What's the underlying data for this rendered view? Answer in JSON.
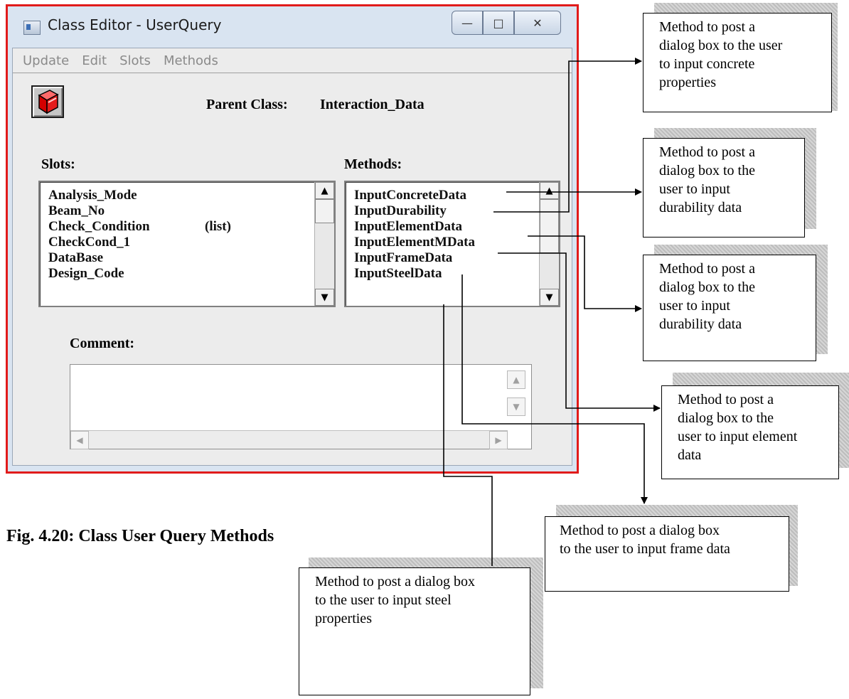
{
  "window": {
    "title": "Class Editor - UserQuery",
    "buttons": {
      "minimize": "—",
      "maximize": "□",
      "close": "✕"
    }
  },
  "menu": [
    "Update",
    "Edit",
    "Slots",
    "Methods"
  ],
  "parent_class": {
    "label": "Parent Class:",
    "value": "Interaction_Data"
  },
  "slots": {
    "label": "Slots:",
    "items": [
      "Analysis_Mode",
      "Beam_No",
      "Check_Condition",
      "CheckCond_1",
      "DataBase",
      "Design_Code"
    ],
    "item_suffix": "(list)"
  },
  "methods": {
    "label": "Methods:",
    "items": [
      "InputConcreteData",
      "InputDurability",
      "InputElementData",
      "InputElementMData",
      "InputFrameData",
      "InputSteelData"
    ]
  },
  "comment": {
    "label": "Comment:",
    "value": ""
  },
  "caption": "Fig. 4.20: Class User Query Methods",
  "callouts": [
    "Method to post a dialog box to the user to input concrete properties",
    "Method to post a dialog box to the user to input durability data",
    "Method to post a dialog box to the user to input durability data",
    "Method to post a dialog box to the user to input element data",
    "Method to post a dialog box to the user to input frame data",
    "Method to post a dialog box to the user to input steel properties"
  ],
  "callout_lines": {
    "c1": [
      "Method to post a",
      "dialog box to the user",
      "to input concrete",
      "properties"
    ],
    "c2": [
      "Method to post a",
      "dialog box to the",
      "user to input",
      "durability data"
    ],
    "c3": [
      "Method to post a",
      "dialog box to the",
      "user to input",
      "durability data"
    ],
    "c4": [
      "Method to post a",
      "dialog box to the",
      "user to input element",
      "data"
    ],
    "c5": [
      "Method to post a dialog box",
      "to the user to input frame data"
    ],
    "c6": [
      "Method to post a dialog box",
      "to the user to input steel",
      "properties"
    ]
  },
  "icons": {
    "app": "window-app-icon",
    "toolbar": "red-book-icon"
  }
}
